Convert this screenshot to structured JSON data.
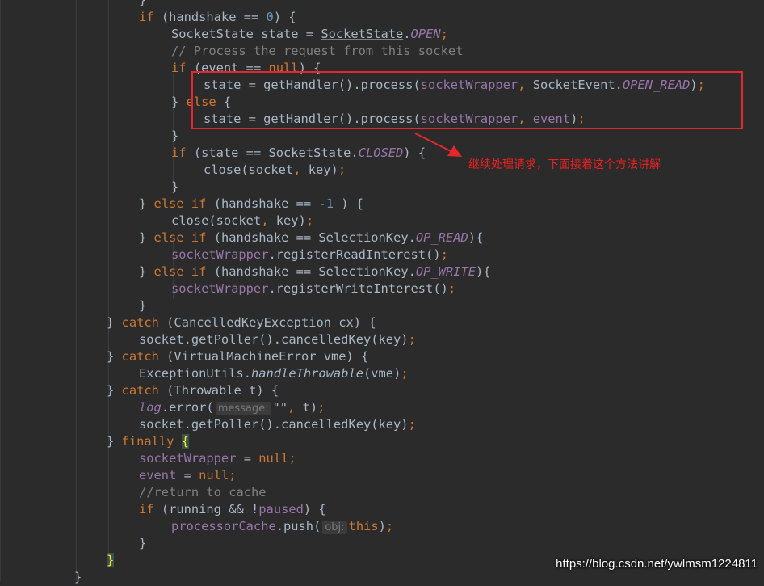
{
  "editor": {
    "lines": [
      [
        {
          "t": "}"
        }
      ],
      [
        {
          "t": "if ",
          "c": "kw"
        },
        {
          "t": "(handshake == "
        },
        {
          "t": "0",
          "c": "num"
        },
        {
          "t": ") {"
        }
      ],
      [
        {
          "t": "SocketState state = "
        },
        {
          "t": "SocketState",
          "c": "strike"
        },
        {
          "t": "."
        },
        {
          "t": "OPEN",
          "c": "field-it"
        },
        {
          "t": ";",
          "c": "kw"
        }
      ],
      [
        {
          "t": "// Process the request from this socket",
          "c": "comment"
        }
      ],
      [
        {
          "t": "if ",
          "c": "kw"
        },
        {
          "t": "(event == "
        },
        {
          "t": "null",
          "c": "kw"
        },
        {
          "t": ") {"
        }
      ],
      [
        {
          "t": "state = getHandler().process("
        },
        {
          "t": "socketWrapper",
          "c": "field"
        },
        {
          "t": ", ",
          "c": "kw"
        },
        {
          "t": "SocketEvent."
        },
        {
          "t": "OPEN_READ",
          "c": "field-it"
        },
        {
          "t": ")"
        },
        {
          "t": ";",
          "c": "kw"
        }
      ],
      [
        {
          "t": "} "
        },
        {
          "t": "else ",
          "c": "kw"
        },
        {
          "t": "{"
        }
      ],
      [
        {
          "t": "state = getHandler().process("
        },
        {
          "t": "socketWrapper",
          "c": "field"
        },
        {
          "t": ", ",
          "c": "kw"
        },
        {
          "t": "event",
          "c": "field"
        },
        {
          "t": ")"
        },
        {
          "t": ";",
          "c": "kw"
        }
      ],
      [
        {
          "t": "}"
        }
      ],
      [
        {
          "t": "if ",
          "c": "kw"
        },
        {
          "t": "(state == SocketState."
        },
        {
          "t": "CLOSED",
          "c": "field-it"
        },
        {
          "t": ") {"
        }
      ],
      [
        {
          "t": "close(socket"
        },
        {
          "t": ", ",
          "c": "kw"
        },
        {
          "t": "key)"
        },
        {
          "t": ";",
          "c": "kw"
        }
      ],
      [
        {
          "t": "}"
        }
      ],
      [
        {
          "t": "} "
        },
        {
          "t": "else if ",
          "c": "kw"
        },
        {
          "t": "(handshake == -"
        },
        {
          "t": "1",
          "c": "num"
        },
        {
          "t": " ) {"
        }
      ],
      [
        {
          "t": "close(socket"
        },
        {
          "t": ", ",
          "c": "kw"
        },
        {
          "t": "key)"
        },
        {
          "t": ";",
          "c": "kw"
        }
      ],
      [
        {
          "t": "} "
        },
        {
          "t": "else if ",
          "c": "kw"
        },
        {
          "t": "(handshake == SelectionKey."
        },
        {
          "t": "OP_READ",
          "c": "field-it"
        },
        {
          "t": "){"
        }
      ],
      [
        {
          "t": "socketWrapper",
          "c": "field"
        },
        {
          "t": ".registerReadInterest()"
        },
        {
          "t": ";",
          "c": "kw"
        }
      ],
      [
        {
          "t": "} "
        },
        {
          "t": "else if ",
          "c": "kw"
        },
        {
          "t": "(handshake == SelectionKey."
        },
        {
          "t": "OP_WRITE",
          "c": "field-it"
        },
        {
          "t": "){"
        }
      ],
      [
        {
          "t": "socketWrapper",
          "c": "field"
        },
        {
          "t": ".registerWriteInterest()"
        },
        {
          "t": ";",
          "c": "kw"
        }
      ],
      [
        {
          "t": "}"
        }
      ],
      [
        {
          "t": "} "
        },
        {
          "t": "catch ",
          "c": "kw"
        },
        {
          "t": "(CancelledKeyException cx) {"
        }
      ],
      [
        {
          "t": "socket.getPoller().cancelledKey(key)"
        },
        {
          "t": ";",
          "c": "kw"
        }
      ],
      [
        {
          "t": "} "
        },
        {
          "t": "catch ",
          "c": "kw"
        },
        {
          "t": "(VirtualMachineError vme) {"
        }
      ],
      [
        {
          "t": "ExceptionUtils."
        },
        {
          "t": "handleThrowable",
          "c": "it"
        },
        {
          "t": "(vme)"
        },
        {
          "t": ";",
          "c": "kw"
        }
      ],
      [
        {
          "t": "} "
        },
        {
          "t": "catch ",
          "c": "kw"
        },
        {
          "t": "(Throwable t) {"
        }
      ],
      [
        {
          "t": "log",
          "c": "field-it"
        },
        {
          "t": ".error("
        },
        {
          "t": "message:",
          "c": "hint"
        },
        {
          "t": "\"\""
        },
        {
          "t": ", ",
          "c": "kw"
        },
        {
          "t": "t)"
        },
        {
          "t": ";",
          "c": "kw"
        }
      ],
      [
        {
          "t": "socket.getPoller().cancelledKey(key)"
        },
        {
          "t": ";",
          "c": "kw"
        }
      ],
      [
        {
          "t": "} "
        },
        {
          "t": "finally ",
          "c": "kw"
        },
        {
          "t": "{",
          "c": "brace-hl"
        }
      ],
      [
        {
          "t": "socketWrapper",
          "c": "field"
        },
        {
          "t": " = "
        },
        {
          "t": "null",
          "c": "kw"
        },
        {
          "t": ";",
          "c": "kw"
        }
      ],
      [
        {
          "t": "event",
          "c": "field"
        },
        {
          "t": " = "
        },
        {
          "t": "null",
          "c": "kw"
        },
        {
          "t": ";",
          "c": "kw"
        }
      ],
      [
        {
          "t": "//return to cache",
          "c": "comment"
        }
      ],
      [
        {
          "t": "if ",
          "c": "kw"
        },
        {
          "t": "(running && !"
        },
        {
          "t": "paused",
          "c": "field"
        },
        {
          "t": ") {"
        }
      ],
      [
        {
          "t": "processorCache",
          "c": "field"
        },
        {
          "t": ".push("
        },
        {
          "t": "obj:",
          "c": "hint"
        },
        {
          "t": "this",
          "c": "kw"
        },
        {
          "t": ")"
        },
        {
          "t": ";",
          "c": "kw"
        }
      ],
      [
        {
          "t": "}"
        }
      ],
      [
        {
          "t": "}",
          "c": "brace-hl"
        }
      ],
      [
        {
          "t": "}"
        }
      ]
    ],
    "indents": [
      4,
      4,
      5,
      5,
      5,
      6,
      5,
      6,
      5,
      5,
      6,
      5,
      4,
      5,
      4,
      5,
      4,
      5,
      4,
      3,
      4,
      3,
      4,
      3,
      4,
      4,
      3,
      4,
      4,
      4,
      4,
      5,
      4,
      3,
      2
    ]
  },
  "annotation": {
    "label": "继续处理请求，下面接着这个方法讲解",
    "color": "#e8262d"
  },
  "watermark": {
    "text": "https://blog.csdn.net/ywlmsm1224811"
  },
  "colors": {
    "background": "#2b2b2b",
    "text": "#a9b7c6",
    "keyword": "#cc7832",
    "number": "#6897bb",
    "field": "#9876aa",
    "comment": "#808080"
  }
}
